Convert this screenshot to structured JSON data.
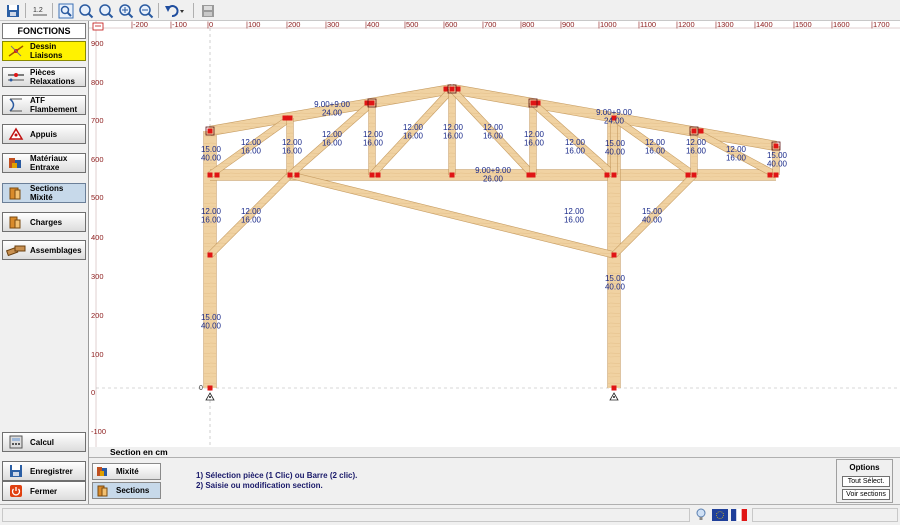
{
  "sidebar": {
    "header": "FONCTIONS",
    "items": [
      {
        "line1": "Dessin",
        "line2": "Liaisons"
      },
      {
        "line1": "Pièces",
        "line2": "Relaxations"
      },
      {
        "line1": "ATF",
        "line2": "Flambement"
      },
      {
        "line1": "Appuis",
        "line2": ""
      },
      {
        "line1": "Matériaux",
        "line2": "Entraxe"
      },
      {
        "line1": "Sections",
        "line2": "Mixité"
      },
      {
        "line1": "Charges",
        "line2": ""
      },
      {
        "line1": "Assemblages",
        "line2": ""
      }
    ],
    "calcul": "Calcul",
    "enregistrer": "Enregistrer",
    "fermer": "Fermer"
  },
  "canvas": {
    "top_ruler_labels": [
      "|-200",
      "|-100",
      "|0",
      "|100",
      "|200",
      "|300",
      "|400",
      "|500",
      "|600",
      "|700",
      "|800",
      "|900",
      "|1000",
      "|1100",
      "|1200",
      "|1300",
      "|1400",
      "|1500",
      "|1600",
      "|1700"
    ],
    "left_ruler_labels": [
      "900",
      "800",
      "700",
      "600",
      "500",
      "400",
      "300",
      "200",
      "100",
      "0",
      "-100"
    ],
    "origin_label": "0",
    "section_labels": [
      "15.00\n40.00",
      "12.00\n16.00",
      "12.00\n16.00",
      "9.00+9.00\n24.00",
      "12.00\n16.00",
      "12.00\n16.00",
      "12.00\n16.00",
      "12.00\n16.00",
      "12.00\n16.00",
      "12.00\n16.00",
      "9.00+9.00\n24.00",
      "15.00\n40.00",
      "12.00\n16.00",
      "12.00\n16.00",
      "12.00\n16.00",
      "12.00\n16.00",
      "9.00+9.00\n26.00",
      "15.00\n40.00",
      "12.00\n16.00",
      "12.00\n16.00",
      "12.00\n16.00",
      "15.00\n40.00",
      "15.00\n40.00"
    ]
  },
  "section_caption": "Section en cm",
  "bottom": {
    "mixite": "Mixité",
    "sections": "Sections",
    "instruction1": "1) Sélection pièce (1 Clic) ou Barre (2 clic).",
    "instruction2": "2) Saisie ou modification section.",
    "options_title": "Options",
    "tout_select": "Tout Sélect.",
    "voir_sections": "Voir sections"
  },
  "colors": {
    "wood": "#f0d2a2",
    "wood_edge": "#c79d63",
    "node": "#e01515",
    "label": "#1a2a8a",
    "ruler": "#8b1a1a",
    "active_yellow": "#fff200",
    "active_blue": "#c7d9ea"
  }
}
